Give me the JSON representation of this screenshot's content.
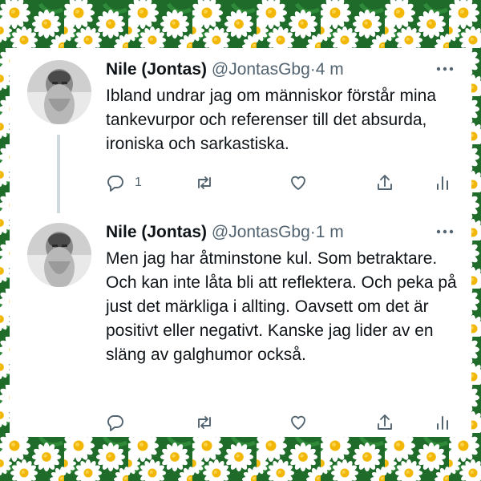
{
  "tweets": [
    {
      "author_name": "Nile (Jontas)",
      "handle": "@JontasGbg",
      "separator": "·",
      "time": "4 m",
      "text": "Ibland undrar jag om människor förstår mina tankevurpor och referenser till det absurda, ironiska och sarkastiska.",
      "reply_count": "1"
    },
    {
      "author_name": "Nile (Jontas)",
      "handle": "@JontasGbg",
      "separator": "·",
      "time": "1 m",
      "text": "Men jag har åtminstone kul. Som betraktare. Och kan inte låta bli att reflektera. Och peka på just det märkliga i allting. Oavsett om det är positivt eller negativt. Kanske jag lider av en släng av galghumor också.",
      "reply_count": ""
    }
  ],
  "colors": {
    "background_green": "#1f6b2a",
    "daisy_petal": "#ffffff",
    "daisy_center": "#f2b705",
    "text_primary": "#0f1419",
    "text_secondary": "#536471",
    "thread_line": "#cfd9de"
  },
  "icons": [
    "more-icon",
    "reply-icon",
    "retweet-icon",
    "like-icon",
    "share-icon",
    "stats-icon"
  ]
}
